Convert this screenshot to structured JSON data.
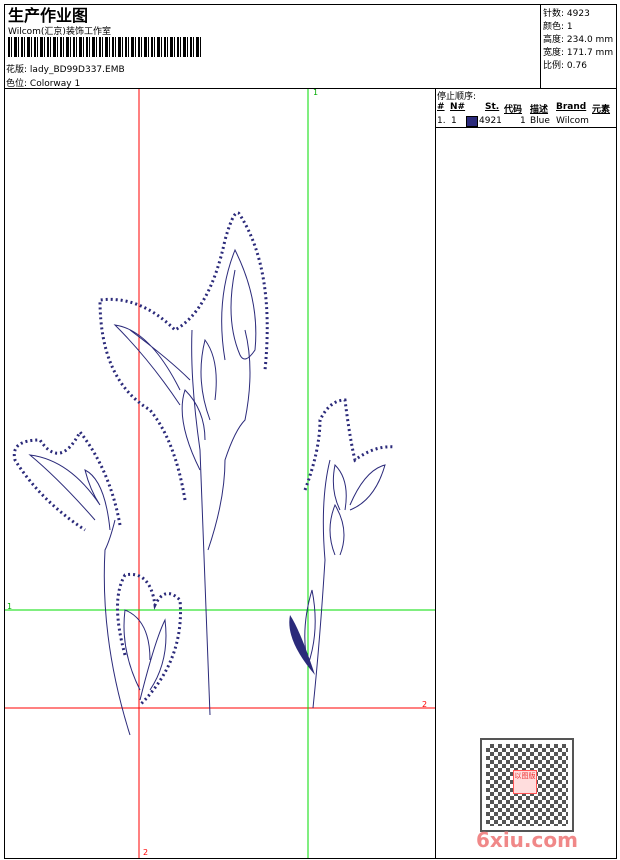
{
  "header": {
    "title": "生产作业图",
    "studio": "Wilcom(汇京)装饰工作室",
    "design_label": "花版:",
    "design_file": "lady_BD99D337.EMB",
    "colorway_label": "色位:",
    "colorway": "Colorway 1"
  },
  "stats": [
    {
      "label": "针数:",
      "value": "4923"
    },
    {
      "label": "颜色:",
      "value": "1"
    },
    {
      "label": "高度:",
      "value": "234.0 mm"
    },
    {
      "label": "宽度:",
      "value": "171.7 mm"
    },
    {
      "label": "比例:",
      "value": "0.76"
    }
  ],
  "stop_sequence": {
    "title": "停止顺序:",
    "columns": [
      "#",
      "N#",
      "St.",
      "代码",
      "描述",
      "Brand",
      "元素"
    ],
    "rows": [
      {
        "index": "1.",
        "n": "1",
        "stitches": "4921",
        "code": "1",
        "desc": "Blue",
        "brand": "Wilcom",
        "color": "#2b2a7a"
      }
    ]
  },
  "guides": {
    "green_label": "1",
    "red_label": "2"
  },
  "watermark": {
    "site": "6xiu.com",
    "seal": "以图版"
  },
  "colors": {
    "thread": "#2b2a7a",
    "green_guide": "#00e000",
    "red_guide": "#ff0000"
  }
}
